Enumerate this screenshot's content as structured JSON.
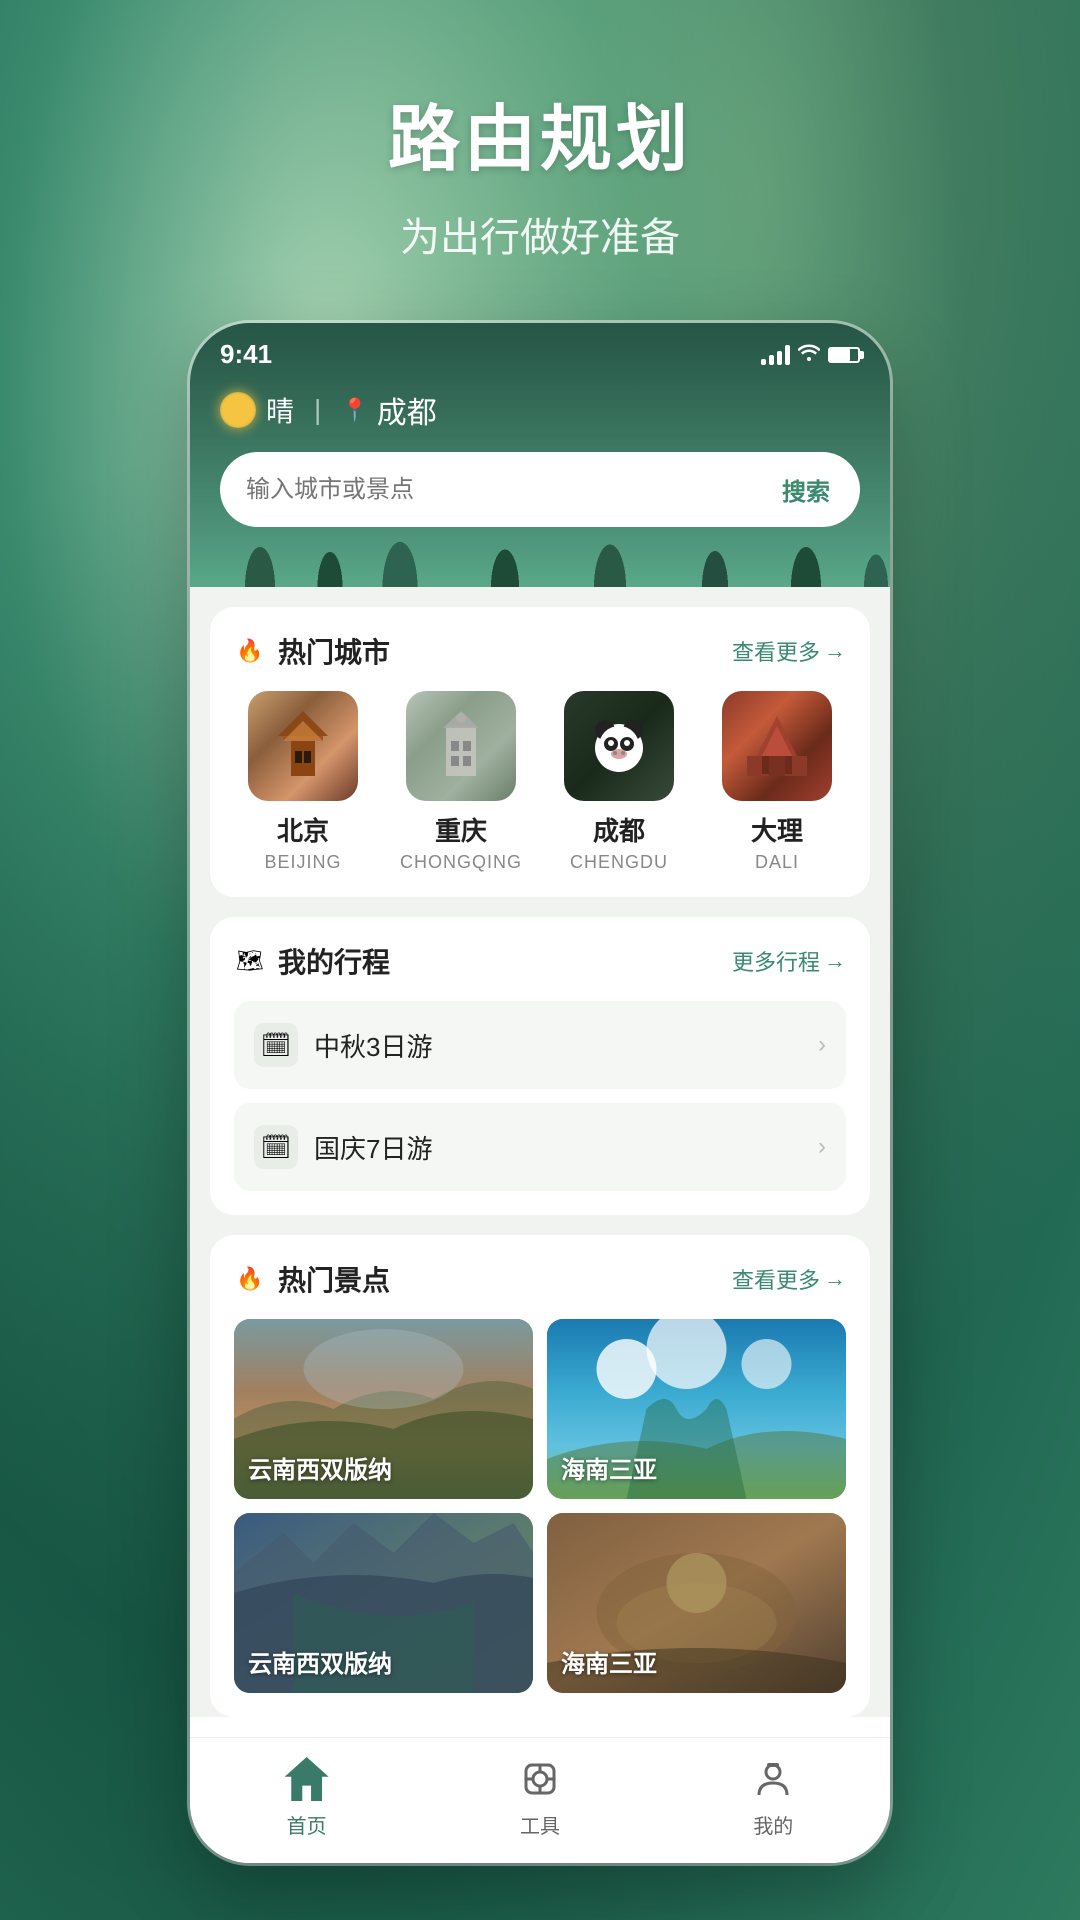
{
  "background": {
    "title": "路由规划",
    "subtitle": "为出行做好准备"
  },
  "statusBar": {
    "time": "9:41",
    "signal": "4 bars",
    "wifi": "on",
    "battery": "70%"
  },
  "weather": {
    "condition": "晴",
    "location": "成都",
    "locationIcon": "pin"
  },
  "search": {
    "placeholder": "输入城市或景点",
    "button": "搜索"
  },
  "hotCities": {
    "title": "热门城市",
    "moreLabel": "查看更多",
    "cities": [
      {
        "zh": "北京",
        "en": "BEIJING"
      },
      {
        "zh": "重庆",
        "en": "CHONGQING"
      },
      {
        "zh": "成都",
        "en": "CHENGDU"
      },
      {
        "zh": "大理",
        "en": "DALI"
      }
    ]
  },
  "myTrips": {
    "title": "我的行程",
    "moreLabel": "更多行程",
    "trips": [
      {
        "name": "中秋3日游"
      },
      {
        "name": "国庆7日游"
      }
    ]
  },
  "hotSpots": {
    "title": "热门景点",
    "moreLabel": "查看更多",
    "spots": [
      {
        "name": "云南西双版纳"
      },
      {
        "name": "海南三亚"
      },
      {
        "name": "云南西双版纳"
      },
      {
        "name": "海南三亚"
      }
    ]
  },
  "tabBar": {
    "tabs": [
      {
        "label": "首页",
        "active": true
      },
      {
        "label": "工具",
        "active": false
      },
      {
        "label": "我的",
        "active": false
      }
    ]
  }
}
